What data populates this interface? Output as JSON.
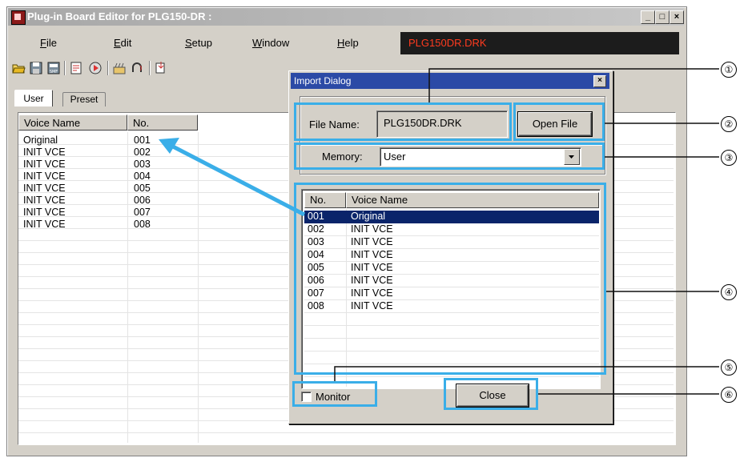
{
  "window": {
    "title": "Plug-in Board Editor for PLG150-DR :"
  },
  "menu": {
    "items": [
      "File",
      "Edit",
      "Setup",
      "Window",
      "Help"
    ],
    "accelerators": [
      "F",
      "E",
      "S",
      "W",
      "H"
    ],
    "status_file": "PLG150DR.DRK"
  },
  "toolbar": {
    "icons": [
      "open-folder-icon",
      "save-icon",
      "save-as-icon",
      "list-edit-icon",
      "play-icon",
      "cut-scissors-icon",
      "headphones-icon",
      "import-icon"
    ]
  },
  "tabs": [
    {
      "label": "User",
      "active": true
    },
    {
      "label": "Preset",
      "active": false
    }
  ],
  "main_list": {
    "columns": [
      "Voice Name",
      "No."
    ],
    "rows": [
      {
        "name": "Original",
        "no": "001"
      },
      {
        "name": "INIT VCE",
        "no": "002"
      },
      {
        "name": "INIT VCE",
        "no": "003"
      },
      {
        "name": "INIT VCE",
        "no": "004"
      },
      {
        "name": "INIT VCE",
        "no": "005"
      },
      {
        "name": "INIT VCE",
        "no": "006"
      },
      {
        "name": "INIT VCE",
        "no": "007"
      },
      {
        "name": "INIT VCE",
        "no": "008"
      }
    ]
  },
  "dialog": {
    "title": "Import Dialog",
    "file_name_label": "File Name:",
    "file_name_value": "PLG150DR.DRK",
    "open_file_button": "Open File",
    "memory_label": "Memory:",
    "memory_value": "User",
    "columns": [
      "No.",
      "Voice Name"
    ],
    "rows": [
      {
        "no": "001",
        "name": "Original",
        "selected": true
      },
      {
        "no": "002",
        "name": "INIT VCE"
      },
      {
        "no": "003",
        "name": "INIT VCE"
      },
      {
        "no": "004",
        "name": "INIT VCE"
      },
      {
        "no": "005",
        "name": "INIT VCE"
      },
      {
        "no": "006",
        "name": "INIT VCE"
      },
      {
        "no": "007",
        "name": "INIT VCE"
      },
      {
        "no": "008",
        "name": "INIT VCE"
      }
    ],
    "monitor_label": "Monitor",
    "monitor_checked": false,
    "close_button": "Close"
  },
  "callouts": [
    "①",
    "②",
    "③",
    "④",
    "⑤",
    "⑥"
  ],
  "colors": {
    "highlight": "#3aaee8",
    "status_text": "#ff3b1f",
    "selection": "#0a246a"
  }
}
